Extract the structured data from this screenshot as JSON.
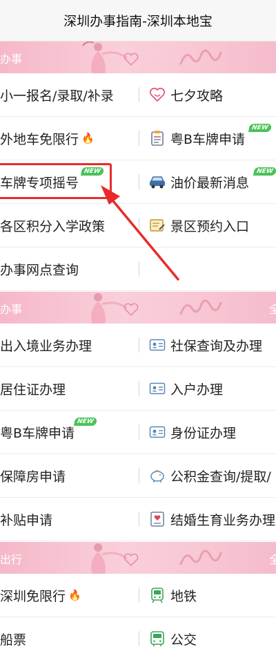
{
  "title": "深圳办事指南-深圳本地宝",
  "sections": [
    {
      "label": "办事",
      "more": "",
      "rows": [
        {
          "left": {
            "label": "小一报名/录取/补录"
          },
          "right": {
            "label": "七夕攻略",
            "icon": "heart-outline-icon"
          }
        },
        {
          "left": {
            "label": "外地车免限行",
            "fire": "🔥"
          },
          "right": {
            "label": "粤B车牌申请",
            "icon": "clipboard-icon",
            "new": "NEW"
          }
        },
        {
          "left": {
            "label": "车牌专项摇号",
            "new": "NEW"
          },
          "right": {
            "label": "油价最新消息",
            "icon": "car-icon",
            "new": "NEW"
          }
        },
        {
          "left": {
            "label": "各区积分入学政策"
          },
          "right": {
            "label": "景区预约入口",
            "icon": "note-icon"
          }
        },
        {
          "left": {
            "label": "办事网点查询"
          },
          "right": {
            "label": ""
          }
        }
      ]
    },
    {
      "label": "办事",
      "more": "全",
      "rows": [
        {
          "left": {
            "label": "出入境业务办理"
          },
          "right": {
            "label": "社保查询及办理",
            "icon": "id-card-icon"
          }
        },
        {
          "left": {
            "label": "居住证办理"
          },
          "right": {
            "label": "入户办理",
            "icon": "id-card-icon"
          }
        },
        {
          "left": {
            "label": "粤B车牌申请",
            "new": "NEW"
          },
          "right": {
            "label": "身份证办理",
            "icon": "id-card-icon"
          }
        },
        {
          "left": {
            "label": "保障房申请"
          },
          "right": {
            "label": "公积金查询/提取/",
            "icon": "piggy-bank-icon"
          }
        },
        {
          "left": {
            "label": "补贴申请"
          },
          "right": {
            "label": "结婚生育业务办理",
            "icon": "heart-card-icon"
          }
        }
      ]
    },
    {
      "label": "出行",
      "more": "全",
      "rows": [
        {
          "left": {
            "label": "深圳免限行",
            "fire": "🔥"
          },
          "right": {
            "label": "地铁",
            "icon": "metro-icon"
          }
        },
        {
          "left": {
            "label": "船票"
          },
          "right": {
            "label": "公交",
            "icon": "bus-icon"
          }
        }
      ]
    }
  ],
  "colors": {
    "accent_red": "#e82a2a",
    "badge_green": "#4cc25a",
    "section_pink": "#f6b8c8",
    "icon_blue": "#5a86b8"
  }
}
